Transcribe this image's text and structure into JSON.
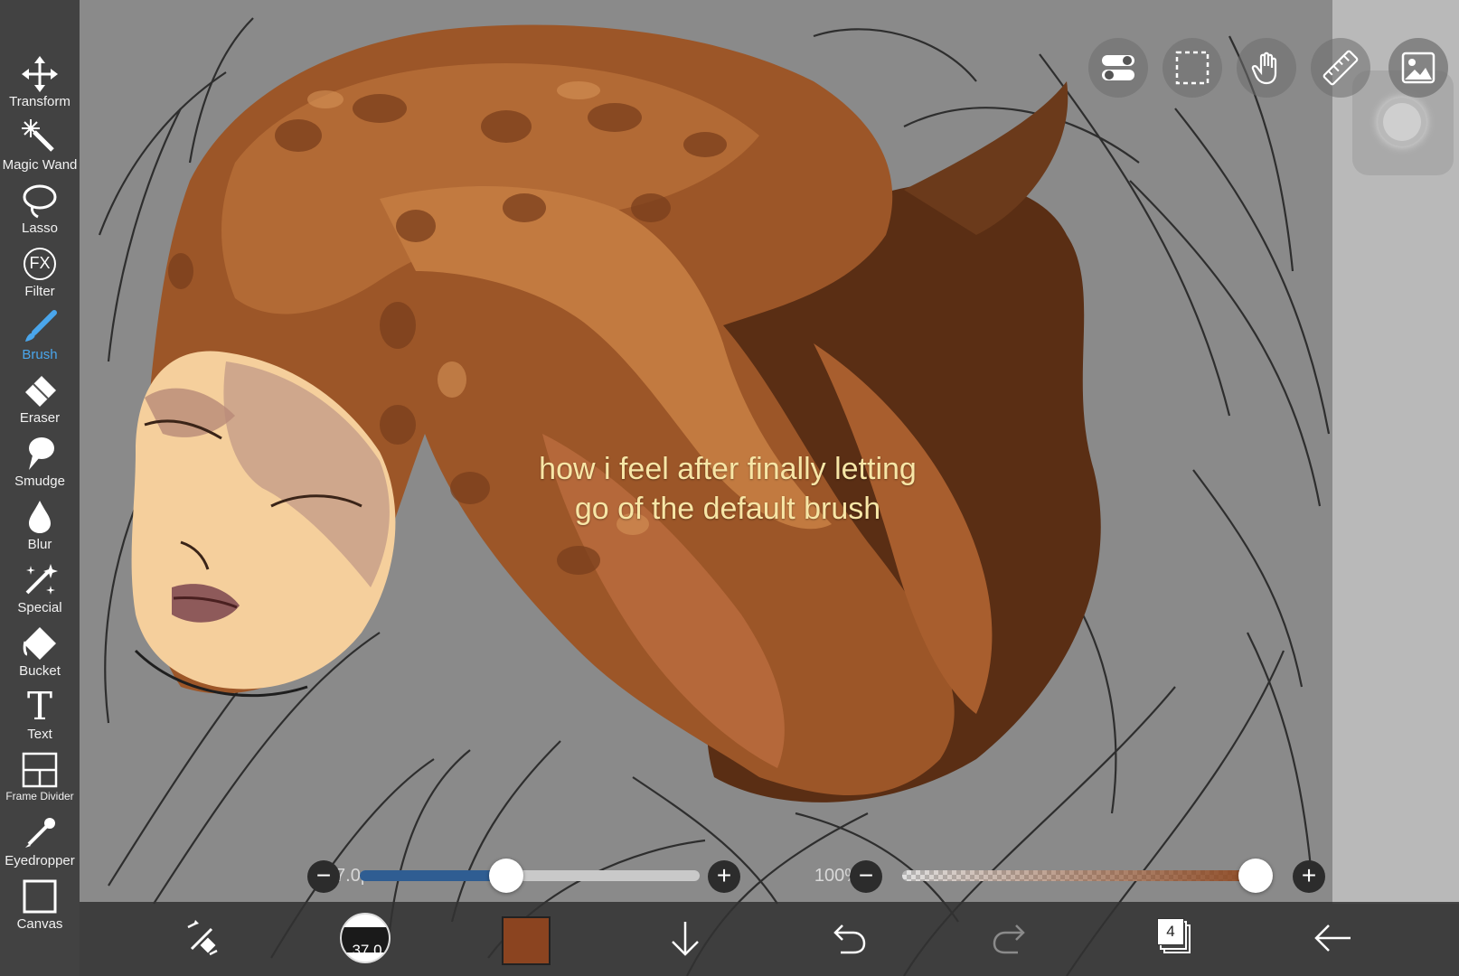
{
  "colors": {
    "canvas_bg": "#8a8a8a",
    "panel_bg": "#3a3a3a",
    "accent": "#4aa6ec",
    "size_fill": "#2f5d92",
    "current_color": "#8b4420",
    "caption": "#f7e6a6"
  },
  "caption": {
    "line1": "how i feel after finally letting",
    "line2": "go of the default brush"
  },
  "tools": [
    {
      "label": "Transform",
      "icon": "move-arrows-icon"
    },
    {
      "label": "Magic Wand",
      "icon": "magic-wand-icon"
    },
    {
      "label": "Lasso",
      "icon": "lasso-icon"
    },
    {
      "label": "Filter",
      "icon": "fx-icon"
    },
    {
      "label": "Brush",
      "icon": "brush-icon",
      "active": true
    },
    {
      "label": "Eraser",
      "icon": "eraser-icon"
    },
    {
      "label": "Smudge",
      "icon": "smudge-icon"
    },
    {
      "label": "Blur",
      "icon": "droplet-icon"
    },
    {
      "label": "Special",
      "icon": "sparkle-icon"
    },
    {
      "label": "Bucket",
      "icon": "bucket-icon"
    },
    {
      "label": "Text",
      "icon": "text-icon"
    },
    {
      "label": "Frame Divider",
      "icon": "frame-divider-icon"
    },
    {
      "label": "Eyedropper",
      "icon": "eyedropper-icon"
    },
    {
      "label": "Canvas",
      "icon": "canvas-icon"
    }
  ],
  "filter_icon_text": "FX",
  "text_icon_text": "T",
  "top_toolbar": [
    "toggle-icon",
    "selection-icon",
    "hand-icon",
    "ruler-icon",
    "image-icon"
  ],
  "brush": {
    "size_label": "37.0px",
    "size_fraction": 0.43,
    "opacity_label": "100%",
    "opacity_fraction": 1.0,
    "preview_value": "37.0"
  },
  "controls": {
    "minus": "−",
    "plus": "+"
  },
  "layers": {
    "count": "4"
  }
}
